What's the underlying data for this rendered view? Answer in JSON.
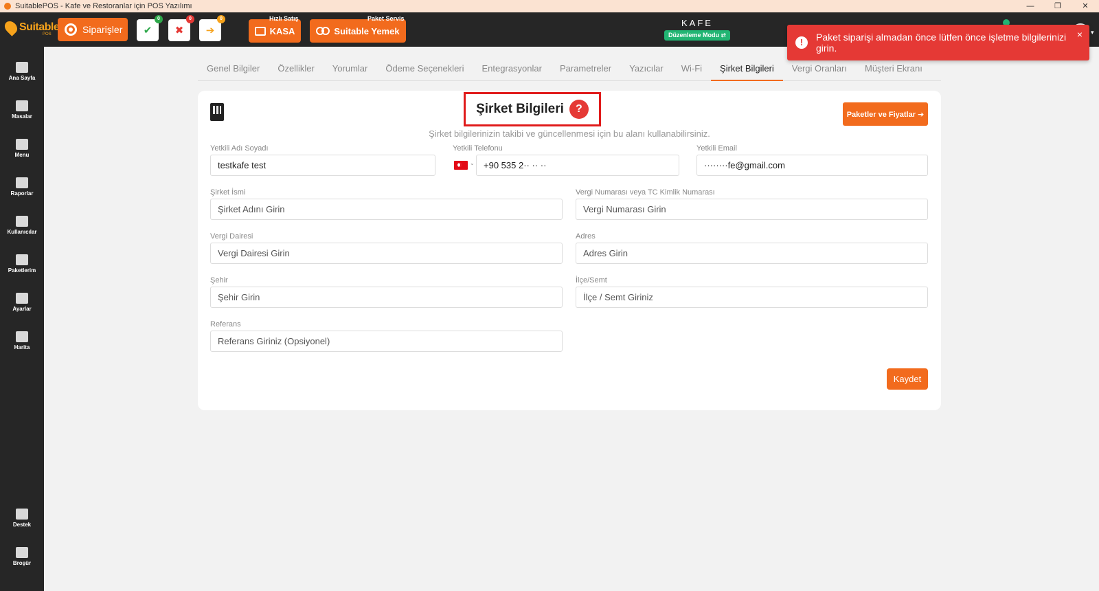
{
  "window": {
    "title": "SuitablePOS - Kafe ve Restoranlar için POS Yazılımı",
    "controls": [
      "—",
      "❐",
      "✕"
    ]
  },
  "header": {
    "logo_text": "Suitable",
    "logo_sub": "POS",
    "orders_label": "Siparişler",
    "quick_buttons": [
      {
        "name": "approve",
        "glyph": "✔",
        "badge": "0",
        "color": "#2ea84a"
      },
      {
        "name": "reject",
        "glyph": "✖",
        "badge": "0",
        "color": "#e53935"
      },
      {
        "name": "forward",
        "glyph": "➔",
        "badge": "0",
        "color": "#f6a21b"
      }
    ],
    "kasa_caption": "Hızlı Satış",
    "kasa_label": "KASA",
    "yemek_caption": "Paket Servis",
    "yemek_label": "Suitable Yemek",
    "venue": "KAFE",
    "mode": "Düzenleme Modu ⇄",
    "notif_count": "0"
  },
  "sidebar": {
    "items": [
      {
        "label": "Ana Sayfa",
        "icon": "home-icon"
      },
      {
        "label": "Masalar",
        "icon": "table-icon"
      },
      {
        "label": "Menu",
        "icon": "utensils-icon"
      },
      {
        "label": "Raporlar",
        "icon": "report-icon"
      },
      {
        "label": "Kullanıcılar",
        "icon": "users-icon"
      },
      {
        "label": "Paketlerim",
        "icon": "gift-icon"
      },
      {
        "label": "Ayarlar",
        "icon": "gears-icon"
      },
      {
        "label": "Harita",
        "icon": "map-icon"
      }
    ],
    "bottom_items": [
      {
        "label": "Destek",
        "icon": "chat-icon"
      },
      {
        "label": "Broşür",
        "icon": "brochure-icon"
      }
    ]
  },
  "toast": {
    "message": "Paket siparişi almadan önce lütfen önce işletme bilgilerinizi girin.",
    "close": "×",
    "color": "#e53935"
  },
  "tabs": [
    "Genel Bilgiler",
    "Özellikler",
    "Yorumlar",
    "Ödeme Seçenekleri",
    "Entegrasyonlar",
    "Parametreler",
    "Yazıcılar",
    "Wi-Fi",
    "Şirket Bilgileri",
    "Vergi Oranları",
    "Müşteri Ekranı"
  ],
  "active_tab": "Şirket Bilgileri",
  "page": {
    "title": "Şirket Bilgileri",
    "help": "?",
    "subtitle": "Şirket bilgilerinizin takibi ve güncellenmesi için bu alanı kullanabilirsiniz.",
    "packages_button": "Paketler ve Fiyatlar ➔",
    "save_button": "Kaydet"
  },
  "form": {
    "contact_name": {
      "label": "Yetkili Adı Soyadı",
      "value": "testkafe test"
    },
    "contact_phone": {
      "label": "Yetkili Telefonu",
      "value": "+90 535 2·· ·· ··"
    },
    "contact_email": {
      "label": "Yetkili Email",
      "value": "········fe@gmail.com"
    },
    "company_name": {
      "label": "Şirket İsmi",
      "placeholder": "Şirket Adını Girin"
    },
    "tax_number": {
      "label": "Vergi Numarası veya TC Kimlik Numarası",
      "placeholder": "Vergi Numarası Girin"
    },
    "tax_office": {
      "label": "Vergi Dairesi",
      "placeholder": "Vergi Dairesi Girin"
    },
    "address": {
      "label": "Adres",
      "placeholder": "Adres Girin"
    },
    "city": {
      "label": "Şehir",
      "placeholder": "Şehir Girin"
    },
    "district": {
      "label": "İlçe/Semt",
      "placeholder": "İlçe / Semt Giriniz"
    },
    "reference": {
      "label": "Referans",
      "placeholder": "Referans Giriniz (Opsiyonel)"
    }
  },
  "colors": {
    "accent": "#f26b1d",
    "dark": "#262626",
    "success": "#22b573"
  }
}
